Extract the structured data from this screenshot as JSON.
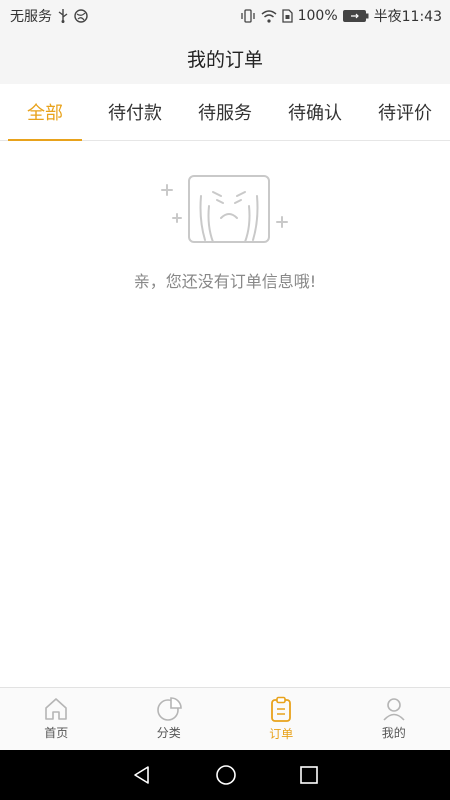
{
  "status_bar": {
    "carrier": "无服务",
    "battery_percent": "100%",
    "time": "半夜11:43",
    "icons": [
      "usb-icon",
      "globe-icon",
      "vibrate-icon",
      "wifi-icon",
      "sim-icon",
      "battery-charging-icon"
    ]
  },
  "header": {
    "title": "我的订单"
  },
  "tabs": [
    {
      "label": "全部",
      "active": true
    },
    {
      "label": "待付款",
      "active": false
    },
    {
      "label": "待服务",
      "active": false
    },
    {
      "label": "待确认",
      "active": false
    },
    {
      "label": "待评价",
      "active": false
    }
  ],
  "empty_state": {
    "icon": "crying-box-icon",
    "message": "亲，您还没有订单信息哦!"
  },
  "bottom_nav": [
    {
      "label": "首页",
      "icon": "home-icon",
      "active": false
    },
    {
      "label": "分类",
      "icon": "pie-chart-icon",
      "active": false
    },
    {
      "label": "订单",
      "icon": "clipboard-icon",
      "active": true
    },
    {
      "label": "我的",
      "icon": "user-icon",
      "active": false
    }
  ],
  "system_nav": {
    "buttons": [
      "back-icon",
      "home-circle-icon",
      "recents-icon"
    ]
  },
  "colors": {
    "accent": "#e8a21b",
    "text": "#222222",
    "muted": "#888888",
    "bar_bg": "#f5f5f5"
  }
}
